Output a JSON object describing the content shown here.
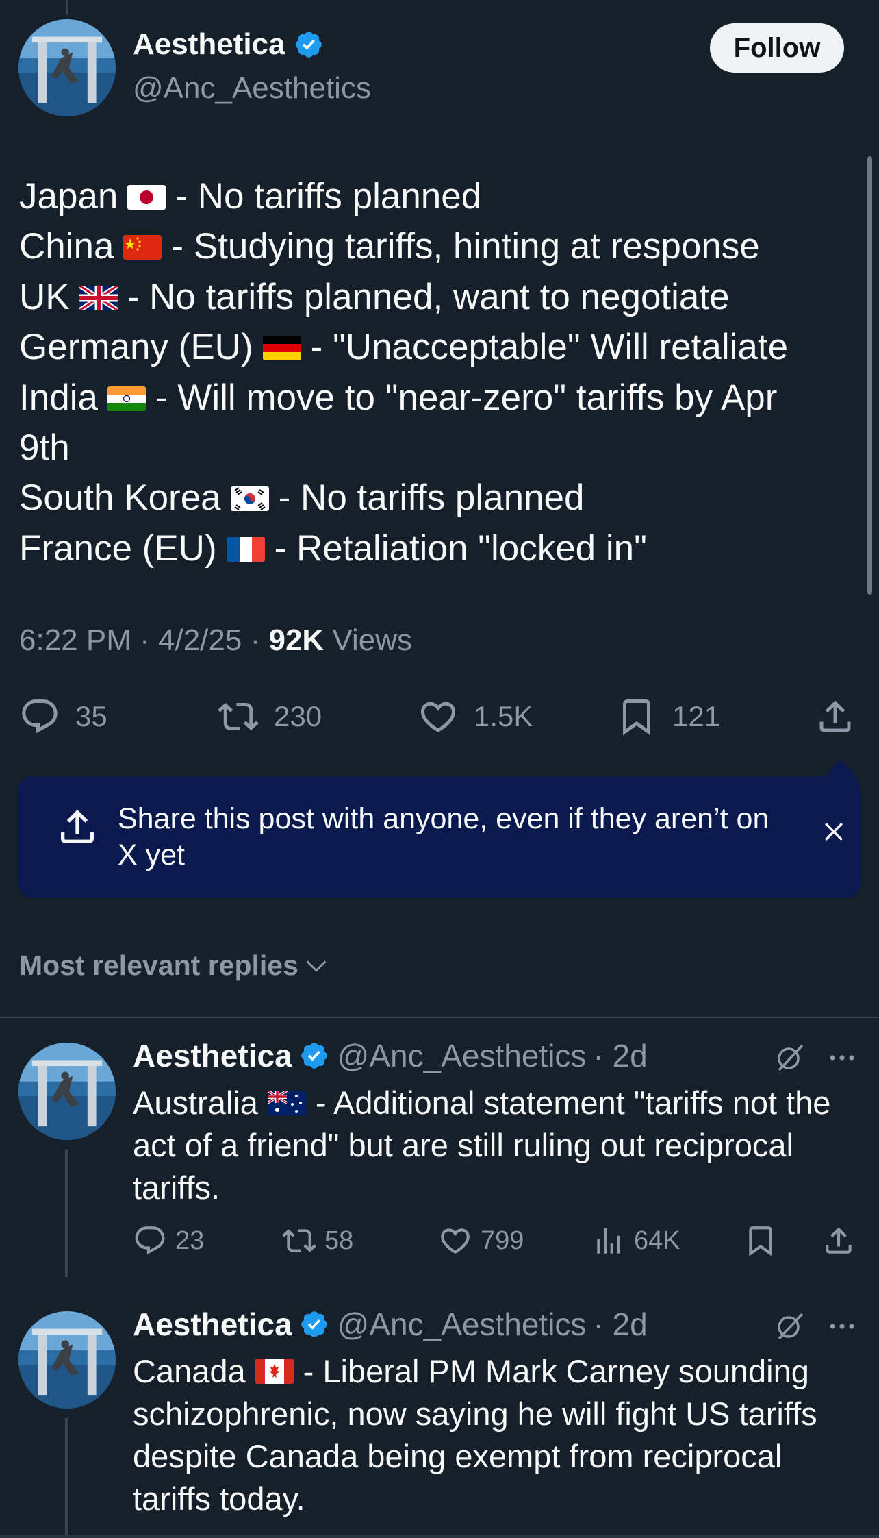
{
  "post": {
    "author_name": "Aesthetica",
    "author_handle": "@Anc_Aesthetics",
    "follow_label": "Follow",
    "lines": [
      {
        "pre": "Japan",
        "flag": "japan-flag-icon",
        "post": "- No tariffs planned"
      },
      {
        "pre": "China",
        "flag": "china-flag-icon",
        "post": "- Studying tariffs, hinting at response"
      },
      {
        "pre": "UK",
        "flag": "uk-flag-icon",
        "post": "- No tariffs planned, want to negotiate"
      },
      {
        "pre": "Germany (EU)",
        "flag": "germany-flag-icon",
        "post": "- \"Unacceptable\" Will retaliate"
      },
      {
        "pre": "India",
        "flag": "india-flag-icon",
        "post": "- Will move to \"near-zero\" tariffs by Apr"
      },
      {
        "pre": "9th",
        "flag": "",
        "post": ""
      },
      {
        "pre": "South Korea",
        "flag": "south-korea-flag-icon",
        "post": "- No tariffs planned"
      },
      {
        "pre": "France (EU)",
        "flag": "france-flag-icon",
        "post": "- Retaliation \"locked in\""
      }
    ],
    "time": "6:22 PM",
    "date": "4/2/25",
    "views_count": "92K",
    "views_label": "Views",
    "sep": "·",
    "replies": "35",
    "reposts": "230",
    "likes": "1.5K",
    "bookmarks": "121"
  },
  "share_banner": {
    "text": "Share this post with anyone, even if they aren’t on X yet"
  },
  "replies_sort": {
    "label": "Most relevant replies"
  },
  "replies": [
    {
      "name": "Aesthetica",
      "handle": "@Anc_Aesthetics",
      "age": "· 2d",
      "text_pre": "Australia",
      "flag": "australia-flag-icon",
      "text_post": "- Additional statement \"tariffs not the act of a friend\" but are still ruling out reciprocal tariffs.",
      "replies": "23",
      "reposts": "58",
      "likes": "799",
      "views": "64K"
    },
    {
      "name": "Aesthetica",
      "handle": "@Anc_Aesthetics",
      "age": "· 2d",
      "text_pre": "Canada",
      "flag": "canada-flag-icon",
      "text_post": "- Liberal PM Mark Carney sounding schizophrenic, now saying he will fight US tariffs despite Canada being exempt from reciprocal tariffs today."
    }
  ],
  "colors": {
    "background": "#15202b",
    "text": "#f7f9f9",
    "muted": "#8b98a5",
    "verified": "#1d9bf0",
    "banner": "#0a1a4f"
  }
}
